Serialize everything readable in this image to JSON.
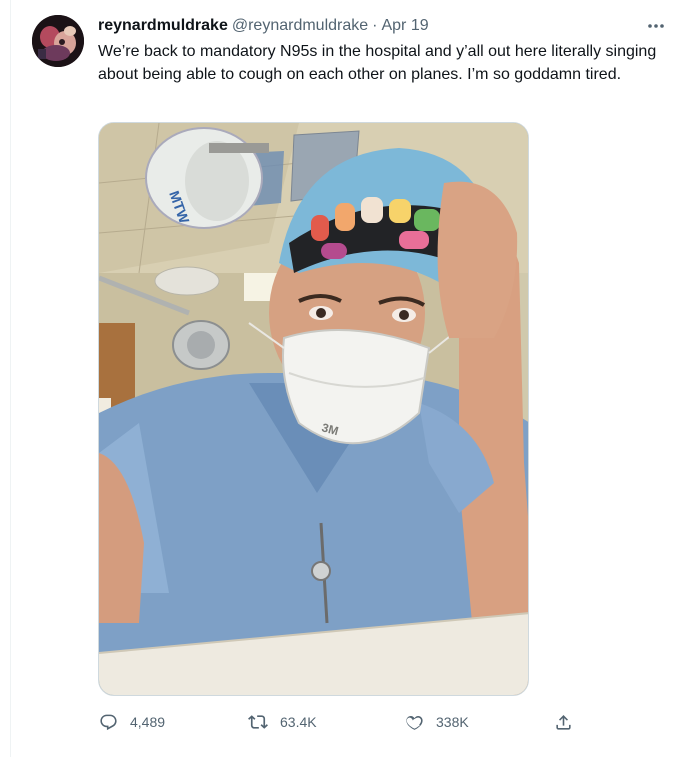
{
  "tweet": {
    "display_name": "reynardmuldrake",
    "handle": "@reynardmuldrake",
    "separator": "·",
    "date": "Apr 19",
    "text": "We’re back to mandatory N95s in the hospital and y’all out here literally singing about being able to cough on each other on planes. I’m so goddamn tired.",
    "more_icon": "ellipsis-icon",
    "media": {
      "kind": "photo",
      "icon": "photo-selfie-nurse-n95",
      "mask_brand": "3M"
    }
  },
  "actions": {
    "reply": {
      "icon": "reply-icon",
      "count": "4,489"
    },
    "retweet": {
      "icon": "retweet-icon",
      "count": "63.4K"
    },
    "like": {
      "icon": "heart-icon",
      "count": "338K"
    },
    "share": {
      "icon": "share-icon"
    }
  },
  "colors": {
    "text_primary": "#0f1419",
    "text_secondary": "#536471",
    "border": "#cfd9de",
    "scrubs": "#7ea0c6",
    "cap": "#7db8d8"
  }
}
